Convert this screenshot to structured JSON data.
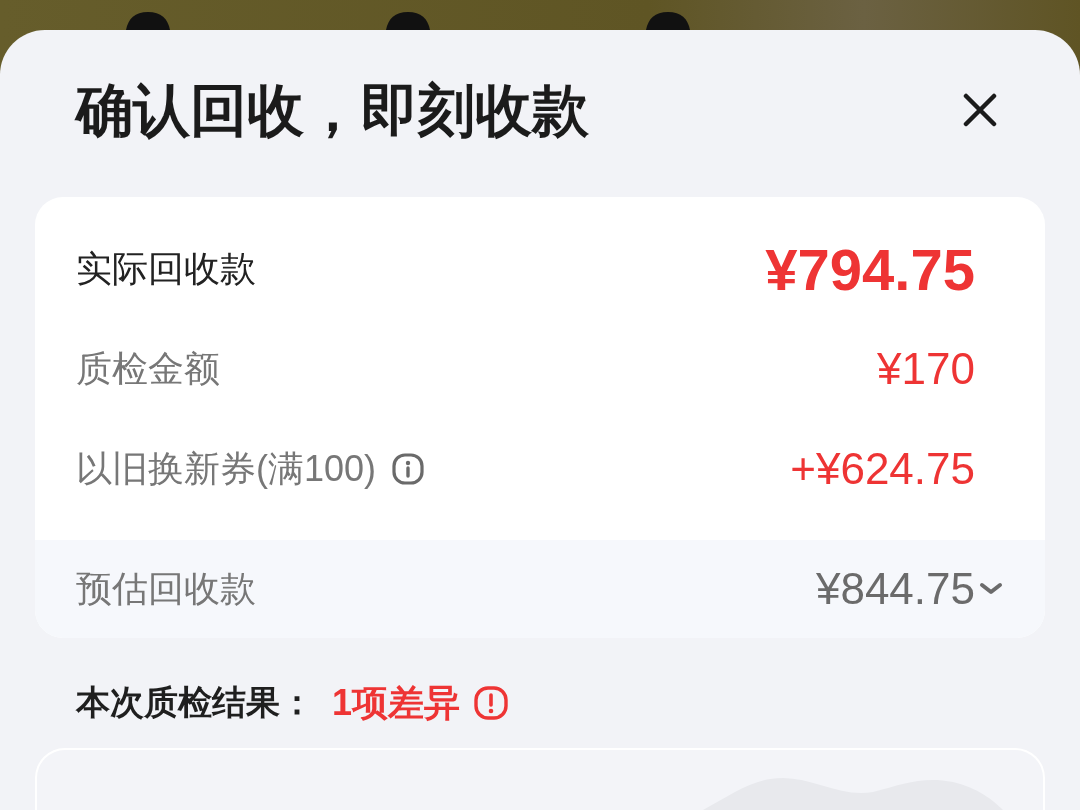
{
  "header": {
    "title": "确认回收，即刻收款"
  },
  "summary": {
    "rows": [
      {
        "kind": "total",
        "label": "实际回收款",
        "value": "¥794.75"
      },
      {
        "kind": "item",
        "label": "质检金额",
        "value": "¥170"
      },
      {
        "kind": "item",
        "label": "以旧换新券(满100)",
        "value": "+¥624.75",
        "info": true
      }
    ],
    "estimate": {
      "label": "预估回收款",
      "value": "¥844.75",
      "expanded": false
    }
  },
  "inspection": {
    "label": "本次质检结果：",
    "result": "1项差异"
  }
}
